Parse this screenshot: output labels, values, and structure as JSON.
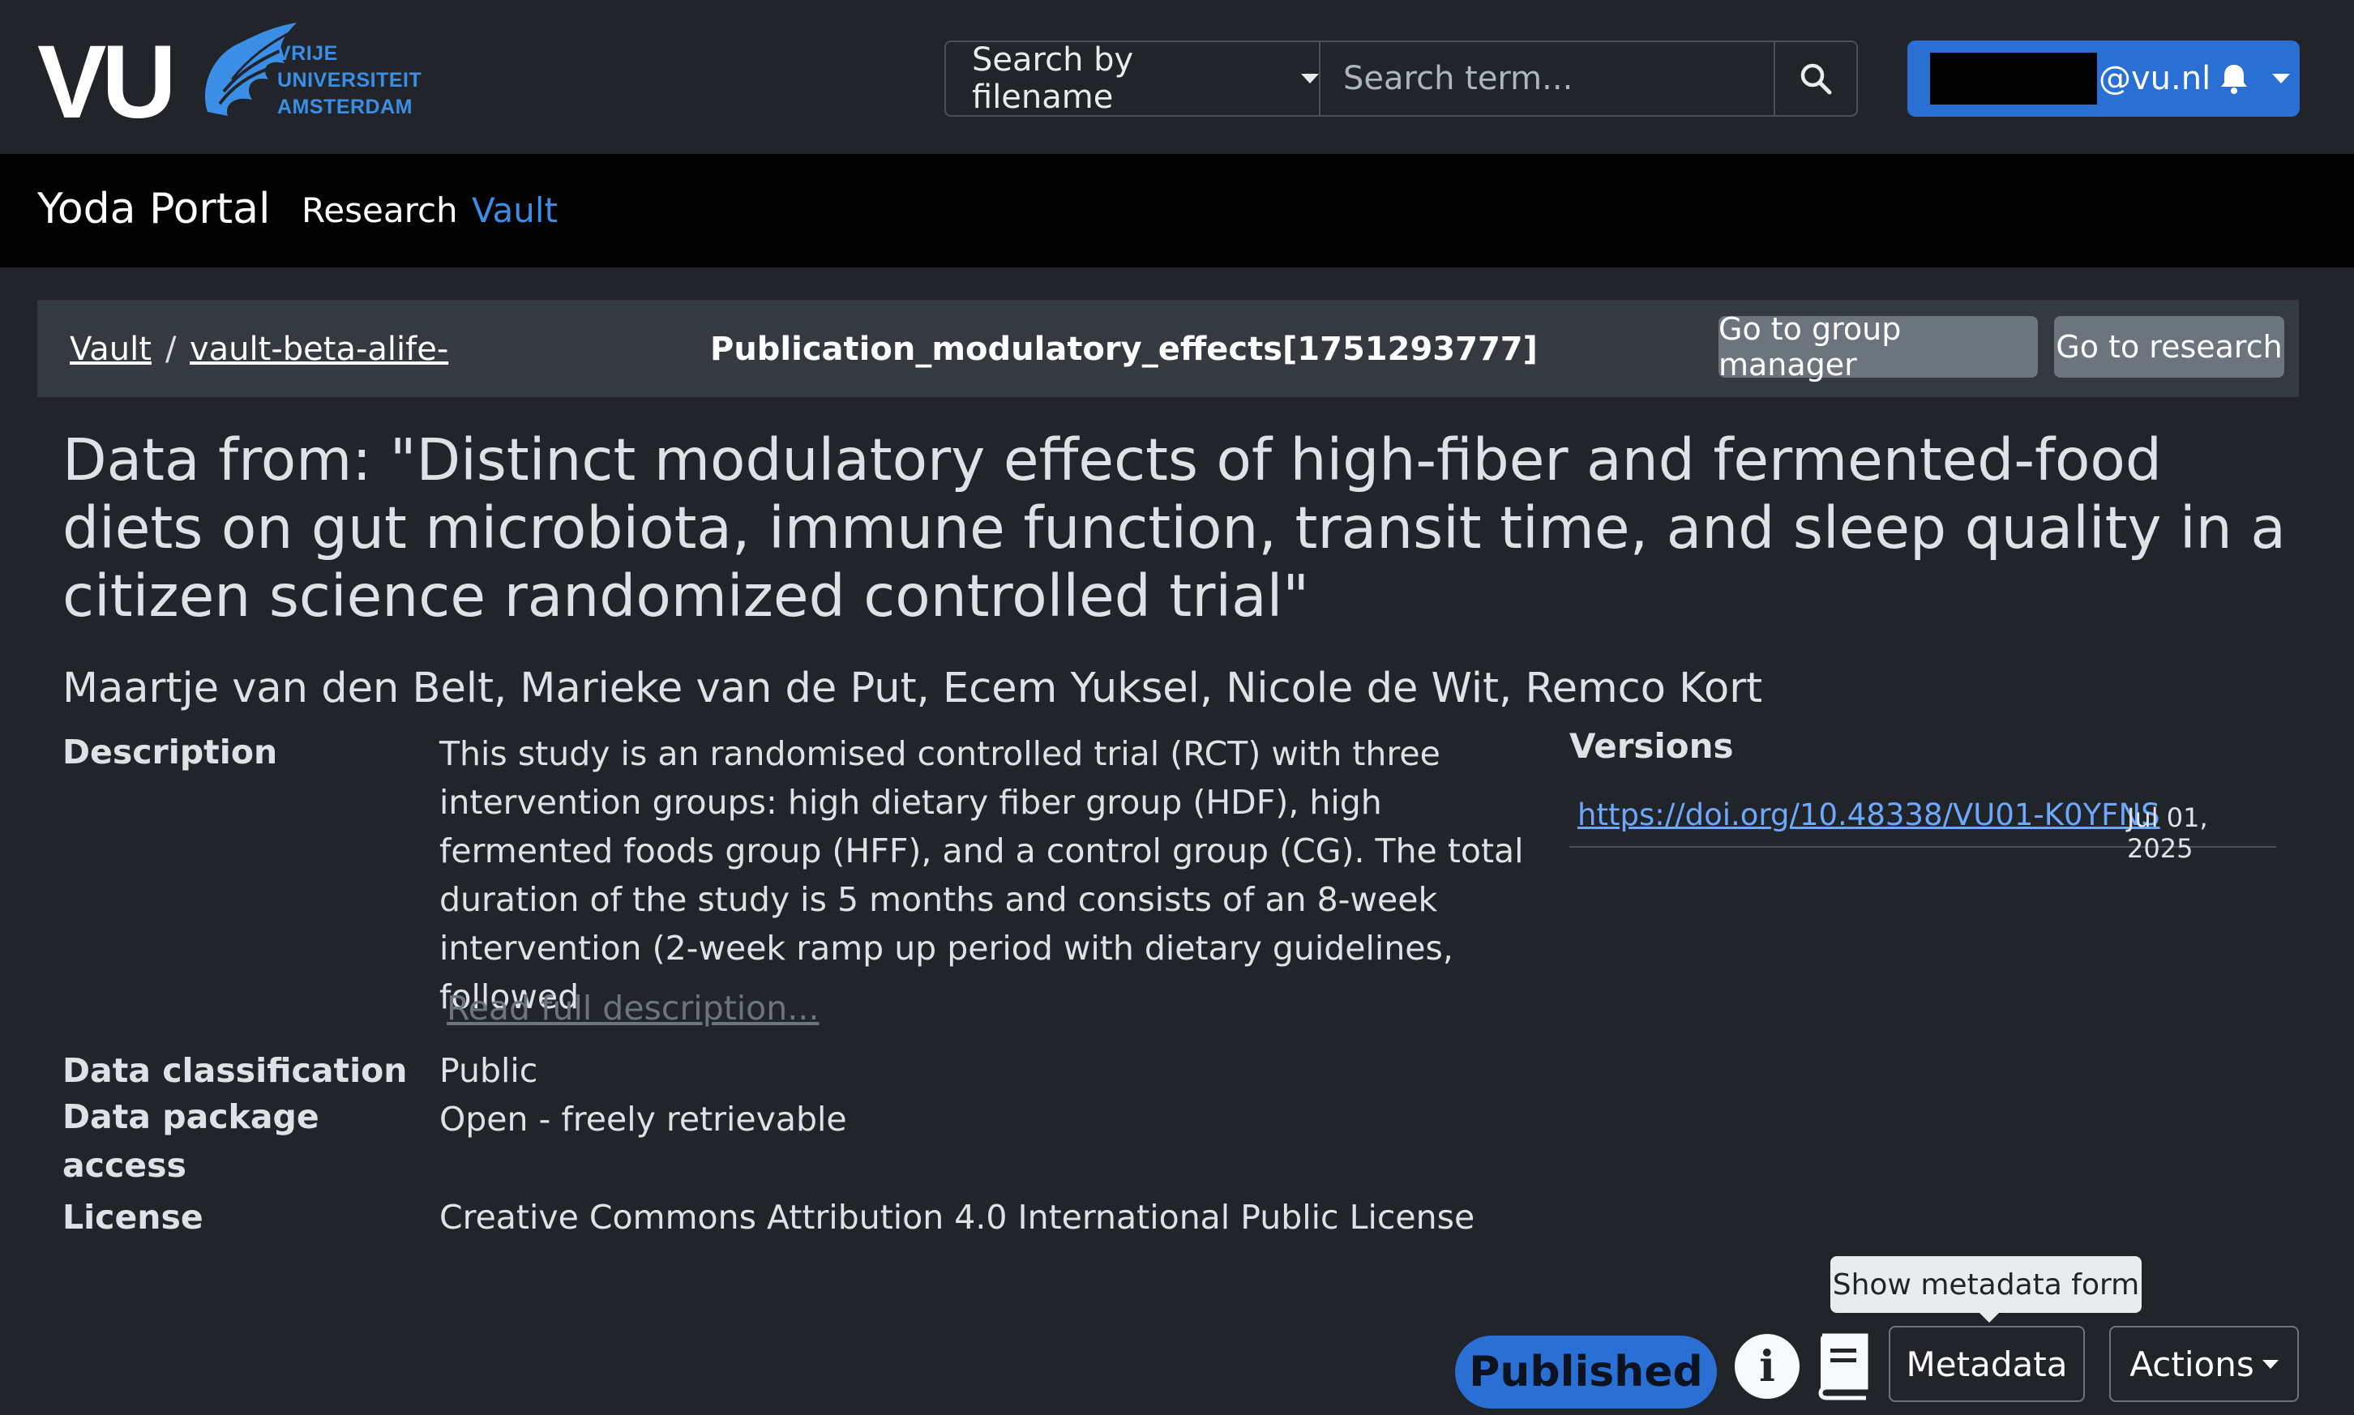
{
  "header": {
    "logo": {
      "mark": "VU",
      "lines": [
        "VRIJE",
        "UNIVERSITEIT",
        "AMSTERDAM"
      ]
    },
    "search": {
      "type_label": "Search by filename",
      "placeholder": "Search term...",
      "button_icon": "search-icon"
    },
    "user": {
      "email_suffix": "@vu.nl",
      "bell_icon": "bell-icon"
    }
  },
  "nav": {
    "brand": "Yoda Portal",
    "items": [
      {
        "label": "Research",
        "active": false
      },
      {
        "label": "Vault",
        "active": true
      }
    ]
  },
  "breadcrumb": {
    "root": "Vault",
    "separator": "/",
    "group": "vault-beta-alife-",
    "folder": "Publication_modulatory_effects[1751293777]",
    "buttons": {
      "group_manager": "Go to group manager",
      "research": "Go to research"
    }
  },
  "package": {
    "title": "Data from: \"Distinct modulatory effects of high-fiber and fermented-food diets on gut microbiota, immune function, transit time, and sleep quality in a citizen science randomized controlled trial\"",
    "authors": "Maartje van den Belt, Marieke van de Put, Ecem Yuksel, Nicole de Wit, Remco Kort",
    "description": {
      "label": "Description",
      "text": "This study is an randomised controlled trial (RCT) with three intervention groups: high dietary fiber group (HDF), high fermented foods group (HFF), and a control group (CG). The total duration of the study is 5 months and consists of an 8-week intervention (2-week ramp up period with dietary guidelines, followed",
      "read_more": "Read full description..."
    },
    "classification": {
      "label": "Data classification",
      "value": "Public"
    },
    "access": {
      "label": "Data package access",
      "value": "Open - freely retrievable"
    },
    "license": {
      "label": "License",
      "value": "Creative Commons Attribution 4.0 International Public License"
    }
  },
  "versions": {
    "heading": "Versions",
    "items": [
      {
        "doi": "https://doi.org/10.48338/VU01-K0YFNS",
        "date": "Jul 01, 2025"
      }
    ]
  },
  "actions": {
    "status_badge": "Published",
    "info_icon": "info-icon",
    "system_metadata_icon": "book-icon",
    "metadata_button": "Metadata",
    "metadata_tooltip": "Show metadata form",
    "actions_button": "Actions"
  },
  "colors": {
    "background": "#212529",
    "navbar": "#000000",
    "breadcrumb_bar": "#343a40",
    "accent_blue": "#2a6fd4",
    "link_blue": "#6ea8fe",
    "secondary_button": "#6c757d"
  }
}
